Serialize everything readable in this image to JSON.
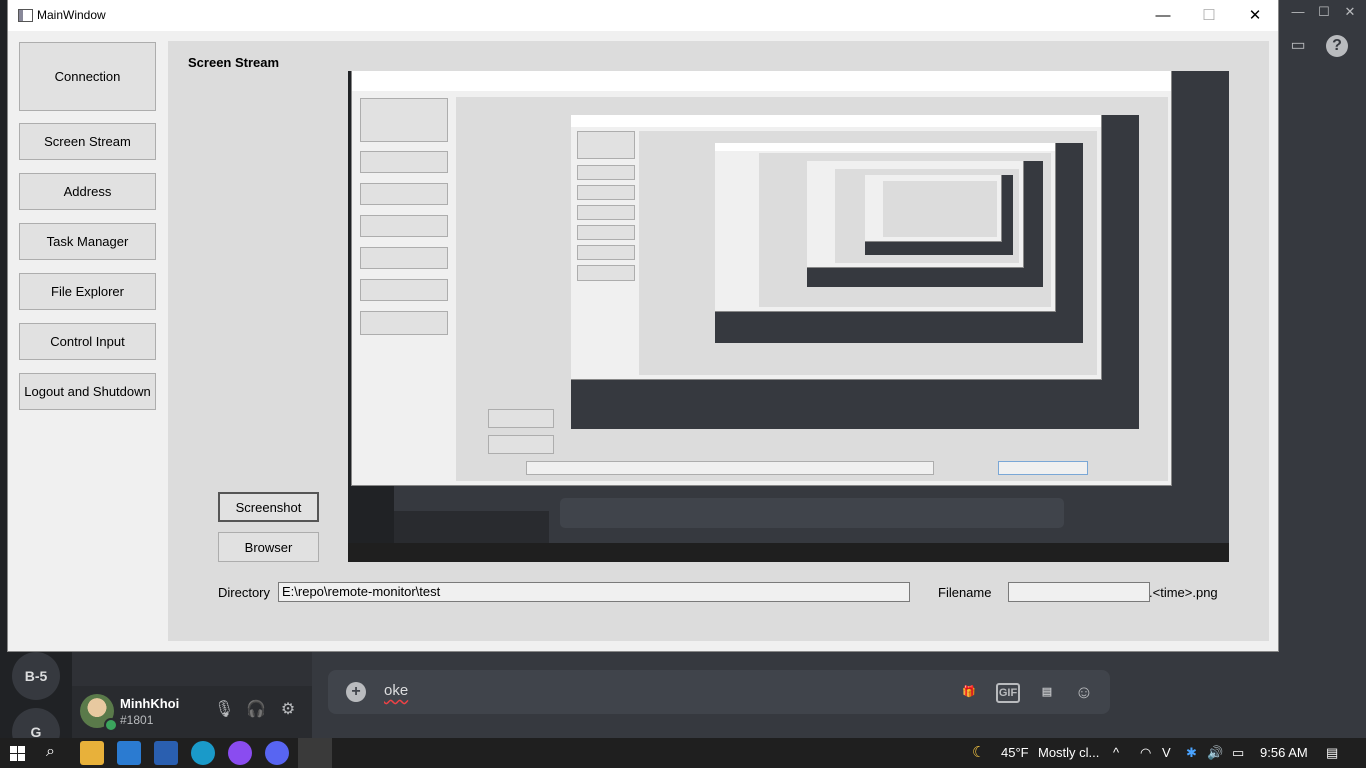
{
  "window": {
    "title": "MainWindow",
    "min": "—",
    "max": "☐",
    "close": "✕"
  },
  "sidebar": {
    "items": [
      {
        "label": "Connection"
      },
      {
        "label": "Screen Stream"
      },
      {
        "label": "Address"
      },
      {
        "label": "Task Manager"
      },
      {
        "label": "File Explorer"
      },
      {
        "label": "Control Input"
      },
      {
        "label": "Logout and Shutdown"
      }
    ]
  },
  "panel": {
    "title": "Screen Stream",
    "screenshot_label": "Screenshot",
    "browser_label": "Browser",
    "directory_label": "Directory",
    "directory_value": "E:\\repo\\remote-monitor\\test",
    "filename_label": "Filename",
    "filename_value": "",
    "filename_suffix": ".<time>.png"
  },
  "discord": {
    "servers": [
      "B-5",
      "G"
    ],
    "username": "MinhKhoi",
    "tag": "#1801",
    "message": "oke",
    "gif_label": "GIF"
  },
  "taskbar": {
    "weather_temp": "45°F",
    "weather_text": "Mostly cl...",
    "time": "9:56 AM"
  },
  "colors": {
    "discord_bg": "#36393f",
    "discord_rail": "#202225",
    "window_bg": "#f0f0f0",
    "panel_bg": "#dcdcdc",
    "taskbar": "#1f1f1f",
    "online": "#3ba55d"
  }
}
